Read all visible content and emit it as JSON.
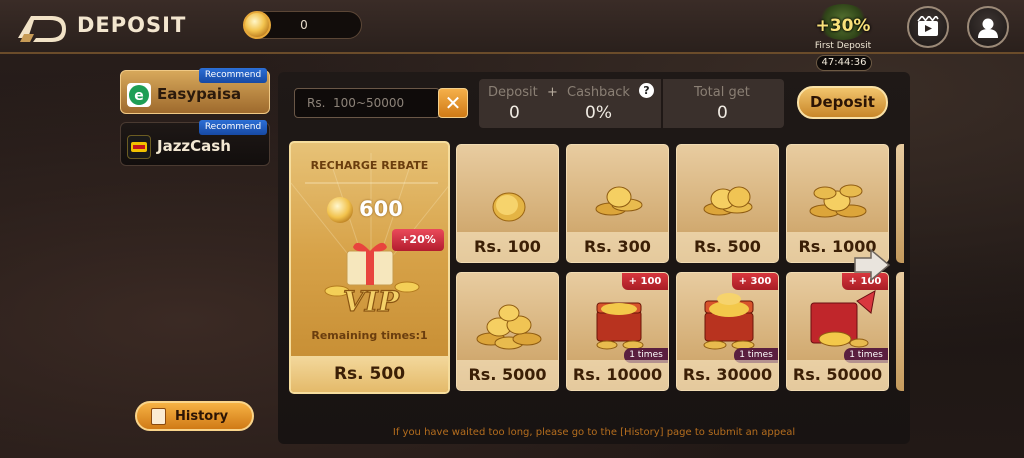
{
  "header": {
    "title": "DEPOSIT",
    "balance": "0"
  },
  "promo": {
    "percent": "+30%",
    "label": "First Deposit",
    "timer": "47:44:36"
  },
  "methods": [
    {
      "name": "Easypaisa",
      "badge": "Recommend",
      "selected": true
    },
    {
      "name": "JazzCash",
      "badge": "Recommend",
      "selected": false
    }
  ],
  "history": {
    "label": "History"
  },
  "amount": {
    "placeholder": "Rs.  100~50000",
    "value": ""
  },
  "summary": {
    "deposit_label": "Deposit",
    "plus": "+",
    "cashback_label": "Cashback",
    "help": "?",
    "deposit_value": "0",
    "cashback_value": "0%",
    "total_label": "Total get",
    "total_value": "0"
  },
  "deposit_button": "Deposit",
  "featured": {
    "title": "RECHARGE REBATE",
    "coins": "600",
    "bonus": "+20%",
    "vip": "VIP",
    "remaining": "Remaining times:1",
    "price": "Rs. 500"
  },
  "tiles": [
    {
      "price": "Rs. 100"
    },
    {
      "price": "Rs. 300"
    },
    {
      "price": "Rs. 500"
    },
    {
      "price": "Rs. 1000"
    },
    {
      "price": "Rs. 5000"
    },
    {
      "price": "Rs. 10000",
      "extra": "+ 100",
      "times": "1 times"
    },
    {
      "price": "Rs. 30000",
      "extra": "+ 300",
      "times": "1 times"
    },
    {
      "price": "Rs. 50000",
      "extra": "+ 100",
      "times": "1 times"
    }
  ],
  "notice": "If you have waited too long, please go to the [History] page to submit an appeal",
  "colors": {
    "accent": "#e9a23a",
    "panel": "#1f1917",
    "badge_blue": "#2c6fd6",
    "bonus_red": "#d8373e"
  }
}
